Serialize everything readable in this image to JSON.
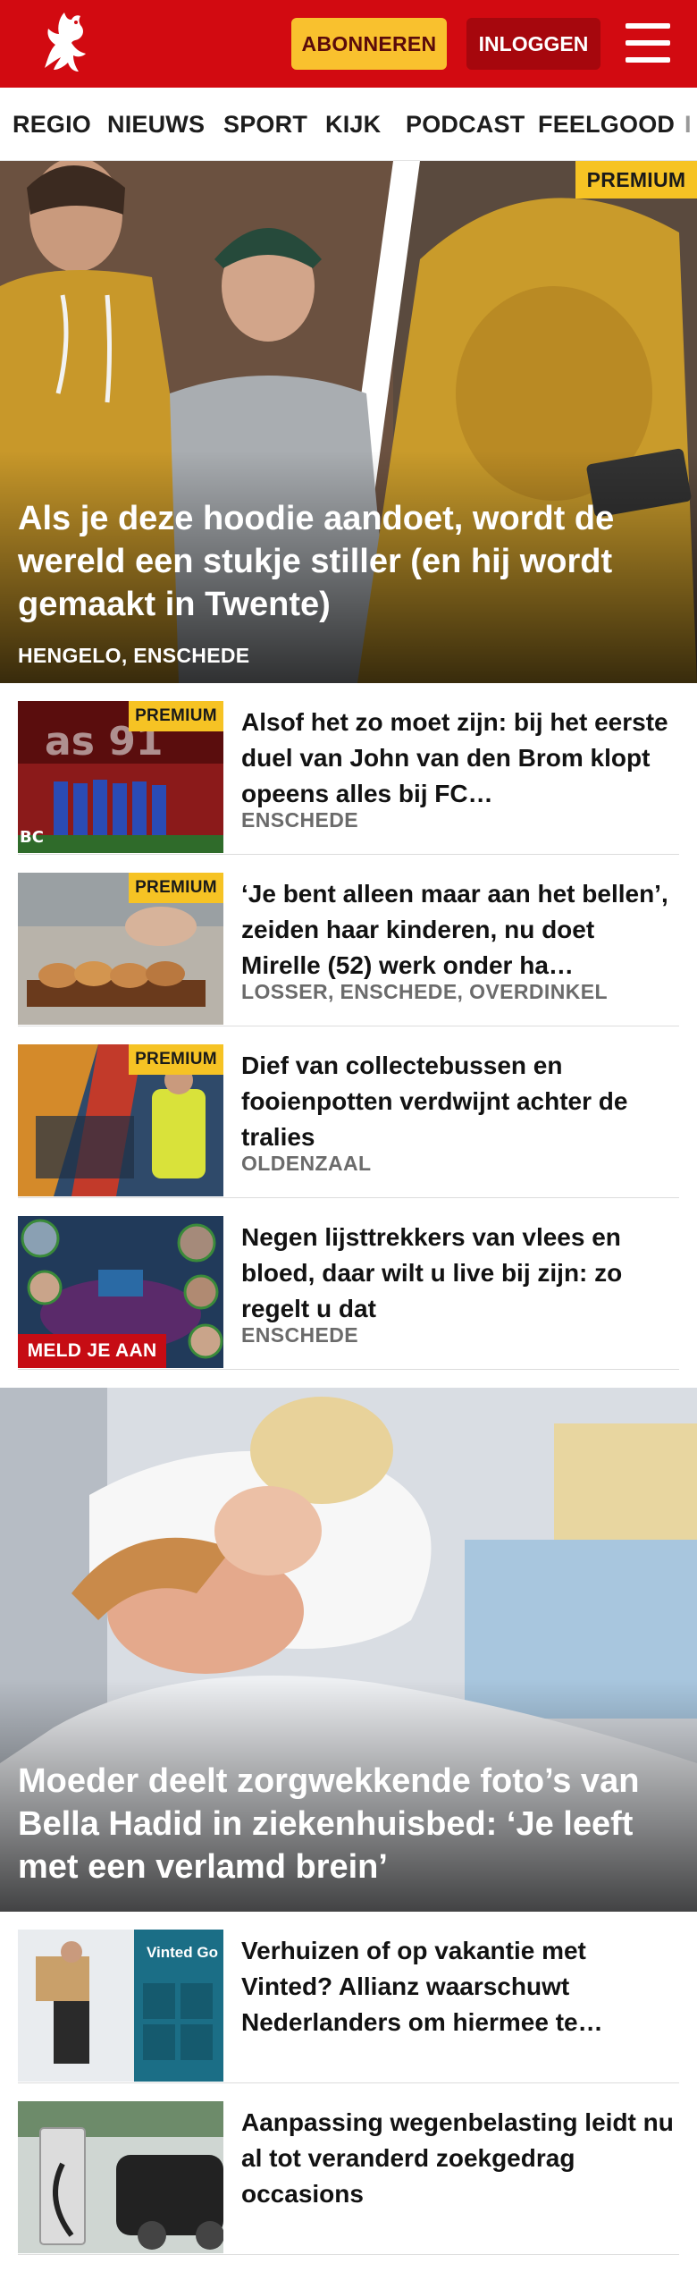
{
  "header": {
    "subscribe_label": "ABONNEREN",
    "login_label": "INLOGGEN",
    "brand_color": "#d20a11",
    "subscribe_color": "#f9c12e",
    "login_color": "#a6070d"
  },
  "nav": {
    "items": [
      "REGIO",
      "NIEUWS",
      "SPORT",
      "KIJK",
      "PODCAST",
      "FEELGOOD",
      "I"
    ]
  },
  "hero1": {
    "premium_label": "PREMIUM",
    "title": "Als je deze hoodie aandoet, wordt de wereld een stukje stiller (en hij wordt gemaakt in Twente)",
    "location": "HENGELO, ENSCHEDE"
  },
  "articles": [
    {
      "premium_label": "PREMIUM",
      "title": "Alsof het zo moet zijn: bij het eerste duel van John van den Brom klopt opeens alles bij FC…",
      "location": "ENSCHEDE"
    },
    {
      "premium_label": "PREMIUM",
      "title": "‘Je bent alleen maar aan het bellen’, zeiden haar kinderen, nu doet Mirelle (52) werk onder ha…",
      "location": "LOSSER, ENSCHEDE, OVERDINKEL"
    },
    {
      "premium_label": "PREMIUM",
      "title": "Dief van collectebussen en fooienpotten verdwijnt achter de tralies",
      "location": "OLDENZAAL"
    },
    {
      "badge_label": "MELD JE AAN",
      "title": "Negen lijsttrekkers van vlees en bloed, daar wilt u live bij zijn: zo regelt u dat",
      "location": "ENSCHEDE"
    }
  ],
  "hero2": {
    "title": "Moeder deelt zorgwekkende foto’s van Bella Hadid in ziekenhuisbed: ‘Je leeft met een verlamd brein’"
  },
  "articles2": [
    {
      "title": "Verhuizen of op vakantie met Vinted? Allianz waarschuwt Nederlanders om hiermee te…",
      "thumb_text": "Vinted Go"
    },
    {
      "title": "Aanpassing wegenbelasting leidt nu al tot veranderd zoekgedrag occasions"
    }
  ]
}
